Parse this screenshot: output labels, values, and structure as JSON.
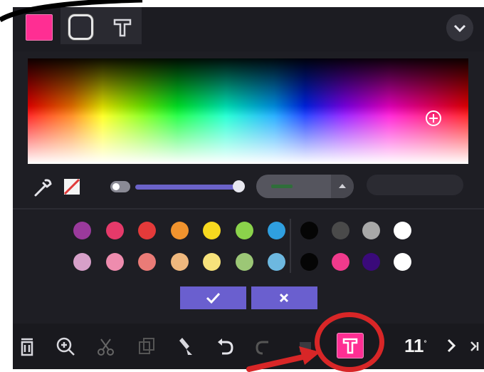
{
  "colors": {
    "current_fill": "#ff2e93",
    "accent": "#6a5fcf",
    "panel_bg": "#1e1e24",
    "annotation_red": "#d82627"
  },
  "tabs": [
    {
      "name": "fill-color-swatch"
    },
    {
      "name": "stroke-tab"
    },
    {
      "name": "text-tab"
    }
  ],
  "palette": {
    "row1": [
      "#9a3a9c",
      "#e53a6a",
      "#e43a3a",
      "#f0932e",
      "#f7d91f",
      "#8bd34b",
      "#2f9fe0"
    ],
    "row2": [
      "#d7a0c9",
      "#ee8cae",
      "#ea7b77",
      "#efb87e",
      "#f7e27b",
      "#9cc776",
      "#6db8e0"
    ],
    "neutrals1": [
      "#050505",
      "#4a4a4a",
      "#a8a8a8",
      "#ffffff"
    ],
    "neutrals2": [
      "#050505",
      "#f03a8c",
      "#3a0a7a",
      "#ffffff"
    ]
  },
  "toolbar": {
    "page_number": "11",
    "page_superscript": "°"
  },
  "icons": [
    "eyedropper-icon",
    "no-color-icon",
    "checkmark-icon",
    "close-icon",
    "trash-icon",
    "zoom-in-icon",
    "scissors-icon",
    "copy-icon",
    "paint-brush-icon",
    "undo-icon",
    "redo-icon",
    "text-tool-icon",
    "chevron-right-icon",
    "skip-to-end-icon",
    "chevron-down-icon"
  ]
}
